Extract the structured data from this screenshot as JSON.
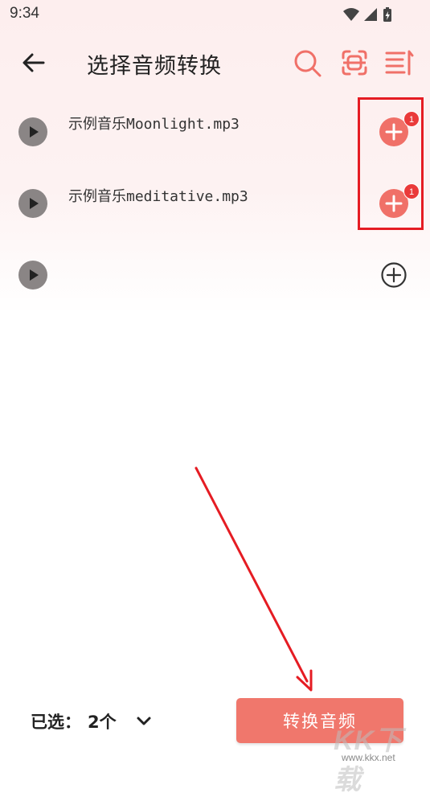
{
  "status_bar": {
    "time": "9:34",
    "icons": [
      "wifi-icon",
      "cellular-signal-icon",
      "battery-charging-icon"
    ]
  },
  "app_bar": {
    "title": "选择音频转换",
    "back_icon": "arrow-left-icon",
    "actions": [
      "search-icon",
      "scan-icon",
      "sort-list-icon"
    ],
    "accent_color": "#f07068"
  },
  "files": [
    {
      "name": "示例音乐Moonlight.mp3",
      "added_count": "1",
      "added": true
    },
    {
      "name": "示例音乐meditative.mp3",
      "added_count": "1",
      "added": true
    },
    {
      "name": "",
      "added_count": "",
      "added": false
    }
  ],
  "bottom_bar": {
    "selected_label": "已选：",
    "selected_count": "2个",
    "expand_icon": "chevron-down-icon",
    "convert_button": "转换音频",
    "button_color": "#f0776c"
  },
  "watermark": {
    "logo_text": "KK下载",
    "url": "www.kkx.net"
  },
  "annotation_color": "#e51c23"
}
